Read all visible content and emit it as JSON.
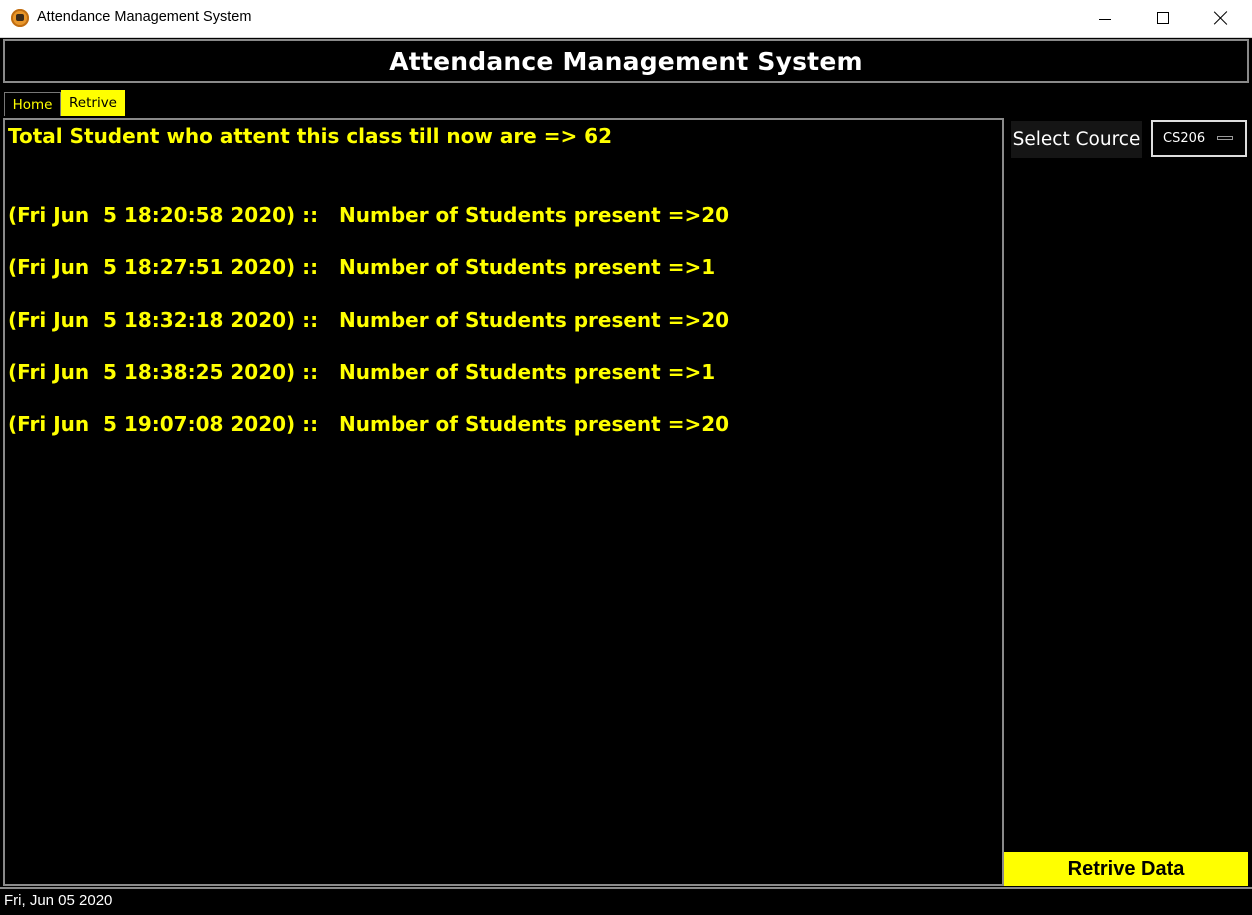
{
  "window": {
    "title": "Attendance Management System",
    "icon": "app-icon"
  },
  "header": {
    "title": "Attendance Management System"
  },
  "tabs": [
    {
      "label": "Home",
      "active": false
    },
    {
      "label": "Retrive",
      "active": true
    }
  ],
  "content": {
    "total_line": "Total Student who attent this class till now are => 62",
    "records": [
      "(Fri Jun  5 18:20:58 2020) ::   Number of Students present =>20",
      "(Fri Jun  5 18:27:51 2020) ::   Number of Students present =>1",
      "(Fri Jun  5 18:32:18 2020) ::   Number of Students present =>20",
      "(Fri Jun  5 18:38:25 2020) ::   Number of Students present =>1",
      "(Fri Jun  5 19:07:08 2020) ::   Number of Students present =>20"
    ]
  },
  "side_panel": {
    "select_label": "Select Cource",
    "course_value": "CS206",
    "retrive_button": "Retrive Data"
  },
  "status_bar": {
    "date": "Fri, Jun 05 2020"
  },
  "colors": {
    "background": "#000000",
    "accent": "#ffff00",
    "text": "#ffffff",
    "border": "#8a8a8a"
  }
}
